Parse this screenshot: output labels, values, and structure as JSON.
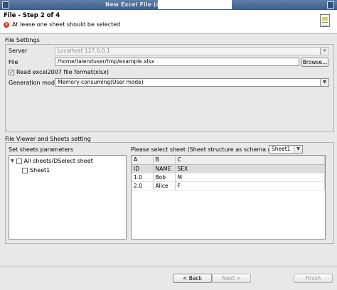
{
  "window": {
    "title": "New Excel File  (on"
  },
  "header": {
    "step": "File - Step 2 of 4",
    "error": "At lease one sheet should be selected"
  },
  "file_settings": {
    "group_title": "File Settings",
    "server_label": "Server",
    "server_value": "Localhost 127.0.0.1",
    "file_label": "File",
    "file_value": "/home/talenduser/tmp/example.xlsx",
    "browse_label": "Browse...",
    "read_excel_label": "Read excel2007 file format(xlsx)",
    "read_excel_checked": true,
    "generation_mode_label": "Generation mode",
    "generation_mode_value": "Memory-consuming(User mode)"
  },
  "file_viewer": {
    "group_title": "File Viewer and Sheets setting",
    "set_sheets_label": "Set sheets parameters",
    "select_sheet_label": "Please select sheet (Sheet structure as schema guide)",
    "sheet_combo_value": "Sheet1",
    "tree": {
      "root": "All sheets/DSelect sheet",
      "children": [
        "Sheet1"
      ]
    },
    "grid": {
      "columns": [
        "A",
        "B",
        "C"
      ],
      "rows": [
        [
          "ID",
          "NAME",
          "SEX"
        ],
        [
          "1.0",
          "Bob",
          "M"
        ],
        [
          "2.0",
          "Alice",
          "F"
        ]
      ]
    }
  },
  "footer": {
    "back": "< Back",
    "next": "Next >",
    "finish": "Finish"
  }
}
